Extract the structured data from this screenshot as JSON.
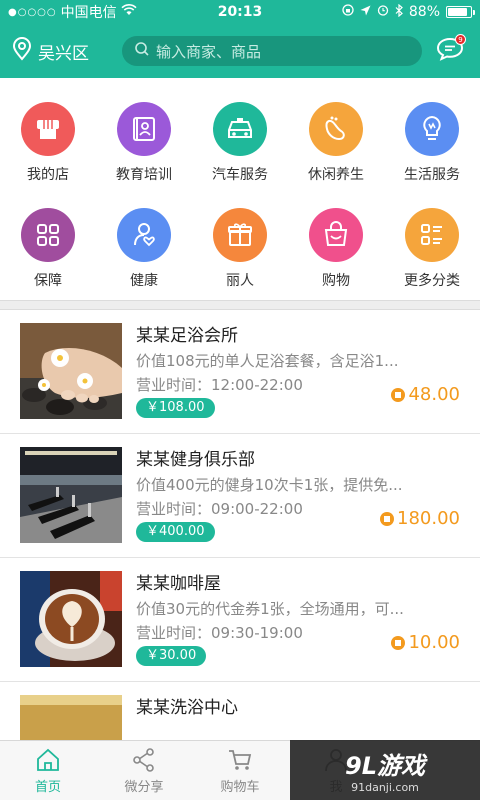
{
  "status_bar": {
    "signal": "●○○○○",
    "carrier": "中国电信",
    "time": "20:13",
    "battery": "88%",
    "battery_level": 0.88
  },
  "header": {
    "location": "吴兴区",
    "search_placeholder": "输入商家、商品",
    "message_badge": "9"
  },
  "categories": [
    {
      "label": "我的店",
      "color": "#f05a5a",
      "icon": "shop-icon"
    },
    {
      "label": "教育培训",
      "color": "#9b59d9",
      "icon": "education-icon"
    },
    {
      "label": "汽车服务",
      "color": "#1fb89a",
      "icon": "car-icon"
    },
    {
      "label": "休闲养生",
      "color": "#f5a53c",
      "icon": "foot-icon"
    },
    {
      "label": "生活服务",
      "color": "#5b8ef2",
      "icon": "bulb-icon"
    },
    {
      "label": "保障",
      "color": "#a04d9e",
      "icon": "grid-icon"
    },
    {
      "label": "健康",
      "color": "#5b8ef2",
      "icon": "health-icon"
    },
    {
      "label": "丽人",
      "color": "#f5873c",
      "icon": "gift-icon"
    },
    {
      "label": "购物",
      "color": "#f0508c",
      "icon": "bag-icon"
    },
    {
      "label": "更多分类",
      "color": "#f5a53c",
      "icon": "list-icon"
    }
  ],
  "shops": [
    {
      "name": "某某足浴会所",
      "desc": "价值108元的单人足浴套餐，含足浴1...",
      "hours": "营业时间：12:00-22:00",
      "price": "￥108.00",
      "coins": "48.00",
      "thumb": "foot-spa"
    },
    {
      "name": "某某健身俱乐部",
      "desc": "价值400元的健身10次卡1张，提供免...",
      "hours": "营业时间：09:00-22:00",
      "price": "￥400.00",
      "coins": "180.00",
      "thumb": "gym"
    },
    {
      "name": "某某咖啡屋",
      "desc": "价值30元的代金券1张，全场通用，可...",
      "hours": "营业时间：09:30-19:00",
      "price": "￥30.00",
      "coins": "10.00",
      "thumb": "coffee"
    },
    {
      "name": "某某洗浴中心",
      "desc": "",
      "hours": "",
      "price": "",
      "coins": "",
      "thumb": "bath"
    }
  ],
  "tabbar": [
    {
      "label": "首页",
      "icon": "home-icon",
      "active": true
    },
    {
      "label": "微分享",
      "icon": "share-icon",
      "active": false
    },
    {
      "label": "购物车",
      "icon": "cart-icon",
      "active": false
    },
    {
      "label": "我",
      "icon": "user-icon",
      "active": false
    }
  ],
  "watermark": {
    "logo": "9L游戏",
    "url": "91danji.com"
  }
}
